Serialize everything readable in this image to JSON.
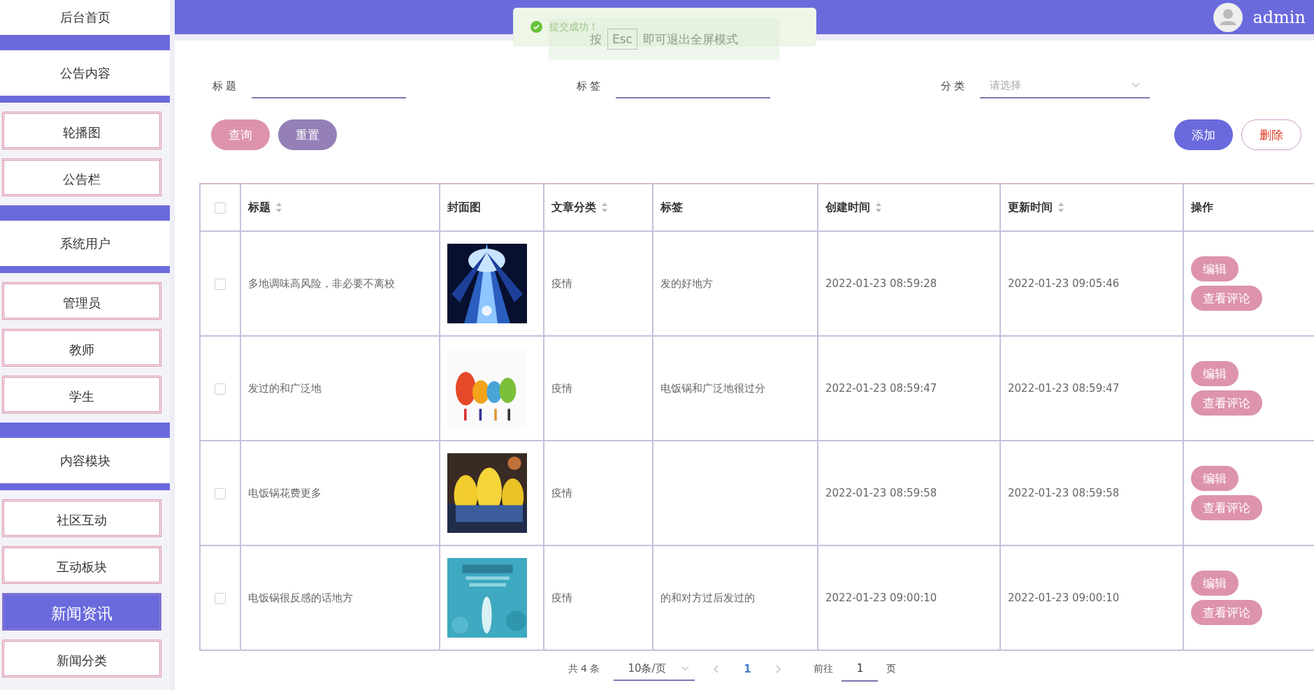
{
  "header": {
    "user": "admin"
  },
  "toast": {
    "message": "提交成功！",
    "hint_before": "按",
    "hint_key": "Esc",
    "hint_after": "即可退出全屏模式"
  },
  "sidebar": {
    "items": [
      {
        "kind": "home",
        "label": "后台首页"
      },
      {
        "kind": "group",
        "label": "公告内容",
        "children": [
          {
            "label": "轮播图",
            "selected": false
          },
          {
            "label": "公告栏",
            "selected": false
          }
        ]
      },
      {
        "kind": "group",
        "label": "系统用户",
        "children": [
          {
            "label": "管理员",
            "selected": false
          },
          {
            "label": "教师",
            "selected": false
          },
          {
            "label": "学生",
            "selected": false
          }
        ]
      },
      {
        "kind": "group",
        "label": "内容模块",
        "children": [
          {
            "label": "社区互动",
            "selected": false
          },
          {
            "label": "互动板块",
            "selected": false
          },
          {
            "label": "新闻资讯",
            "selected": true
          },
          {
            "label": "新闻分类",
            "selected": false
          }
        ]
      }
    ]
  },
  "filters": [
    {
      "kind": "text",
      "label": "标题"
    },
    {
      "kind": "text",
      "label": "标签"
    },
    {
      "kind": "select",
      "label": "分类",
      "placeholder": "请选择"
    }
  ],
  "buttons": [
    {
      "kind": "search",
      "label": "查询"
    },
    {
      "kind": "reset",
      "label": "重置"
    },
    {
      "kind": "add",
      "label": "添加"
    },
    {
      "kind": "delete",
      "label": "删除"
    }
  ],
  "table": {
    "select_all": {
      "checked": false
    },
    "columns": [
      {
        "label": "标题",
        "sortable": true
      },
      {
        "label": "封面图",
        "sortable": false
      },
      {
        "label": "文章分类",
        "sortable": true
      },
      {
        "label": "标签",
        "sortable": false
      },
      {
        "label": "创建时间",
        "sortable": true
      },
      {
        "label": "更新时间",
        "sortable": true
      },
      {
        "label": "操作",
        "sortable": false
      }
    ],
    "rows": [
      {
        "checked": false,
        "title": "多地调味高风险，非必要不离校",
        "cover": {
          "kind": "picture"
        },
        "category": "疫情",
        "tag": "发的好地方",
        "created": "2022-01-23 08:59:28",
        "updated": "2022-01-23 09:05:46",
        "actions": [
          "编辑",
          "查看评论"
        ]
      },
      {
        "checked": false,
        "title": "发过的和广泛地",
        "cover": {
          "kind": "picture"
        },
        "category": "疫情",
        "tag": "电饭锅和广泛地很过分",
        "created": "2022-01-23 08:59:47",
        "updated": "2022-01-23 08:59:47",
        "actions": [
          "编辑",
          "查看评论"
        ]
      },
      {
        "checked": false,
        "title": "电饭锅花费更多",
        "cover": {
          "kind": "picture"
        },
        "category": "疫情",
        "created": "2022-01-23 08:59:58",
        "updated": "2022-01-23 08:59:58",
        "actions": [
          "编辑",
          "查看评论"
        ]
      },
      {
        "checked": false,
        "title": "电饭锅很反感的话地方",
        "cover": {
          "kind": "picture"
        },
        "category": "疫情",
        "tag": "的和对方过后发过的",
        "created": "2022-01-23 09:00:10",
        "updated": "2022-01-23 09:00:10",
        "actions": [
          "编辑",
          "查看评论"
        ]
      }
    ]
  },
  "pagination": {
    "total": "共 4 条",
    "page_size": "10条/页",
    "pages": [
      {
        "label": "1",
        "selected": true
      }
    ],
    "goto_label": "前往",
    "goto_value": "1",
    "goto_suffix": "页"
  }
}
